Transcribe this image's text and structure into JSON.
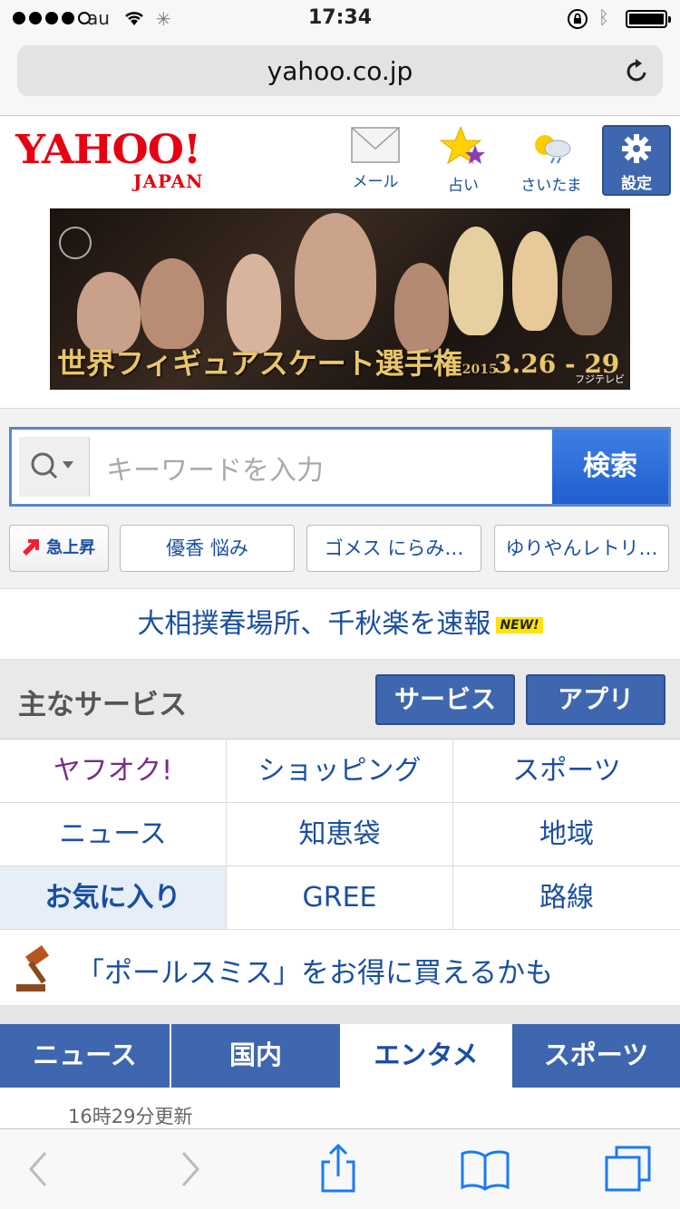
{
  "status": {
    "carrier": "au",
    "time": "17:34"
  },
  "browser": {
    "url": "yahoo.co.jp"
  },
  "header": {
    "logo_main": "YAHOO!",
    "logo_sub": "JAPAN",
    "mail_label": "メール",
    "fortune_label": "占い",
    "weather_label": "さいたま",
    "settings_label": "設定"
  },
  "banner": {
    "title": "世界フィギュアスケート選手権",
    "year": "2015",
    "dates": "3.26 - 29",
    "channel": "フジテレビ"
  },
  "search": {
    "placeholder": "キーワードを入力",
    "button": "検索",
    "trends": [
      "急上昇",
      "優香 悩み",
      "ゴメス にらみ…",
      "ゆりやんレトリ…"
    ]
  },
  "headline": {
    "text": "大相撲春場所、千秋楽を速報",
    "badge": "NEW!"
  },
  "services": {
    "title": "主なサービス",
    "btn_services": "サービス",
    "btn_apps": "アプリ",
    "grid": [
      "ヤフオク!",
      "ショッピング",
      "スポーツ",
      "ニュース",
      "知恵袋",
      "地域",
      "お気に入り",
      "GREE",
      "路線"
    ]
  },
  "ad": {
    "text": "「ポールスミス」をお得に買えるかも"
  },
  "tabs": [
    "ニュース",
    "国内",
    "エンタメ",
    "スポーツ"
  ],
  "updated": "16時29分更新",
  "colors": {
    "brand_red": "#e60012",
    "nav_blue": "#3f67b0",
    "link_blue": "#1a4fa0",
    "search_blue": "#2a6bd9"
  }
}
